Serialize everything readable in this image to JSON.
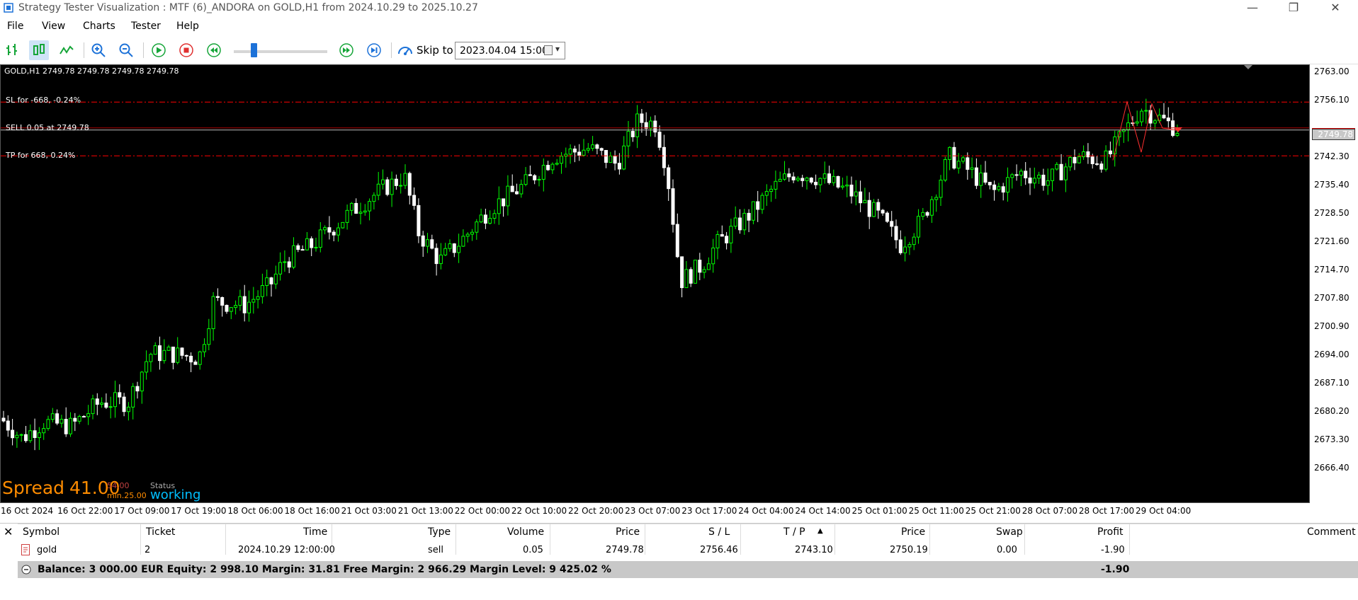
{
  "window": {
    "title": "Strategy Tester Visualization : MTF (6)_ANDORA on GOLD,H1 from 2024.10.29 to 2025.10.27"
  },
  "menu": [
    "File",
    "View",
    "Charts",
    "Tester",
    "Help"
  ],
  "toolbar": {
    "skip_label": "Skip to",
    "skip_date": "2023.04.04 15:00",
    "speed_level": 0.18
  },
  "chart": {
    "symbol_line": "GOLD,H1  2749.78 2749.78 2749.78 2749.78",
    "sl_label": "SL for -668, -0.24%",
    "sell_label": "SELL 0.05 at 2749.78",
    "tp_label": "TP for 668, 0.24%",
    "current_price": "2749.78",
    "price_ticks": [
      "2763.00",
      "2756.10",
      "2742.30",
      "2735.40",
      "2728.50",
      "2721.60",
      "2714.70",
      "2707.80",
      "2700.90",
      "2694.00",
      "2687.10",
      "2680.20",
      "2673.30",
      "2666.40"
    ],
    "time_ticks": [
      "16 Oct 2024",
      "16 Oct 22:00",
      "17 Oct 09:00",
      "17 Oct 19:00",
      "18 Oct 06:00",
      "18 Oct 16:00",
      "21 Oct 03:00",
      "21 Oct 13:00",
      "22 Oct 00:00",
      "22 Oct 10:00",
      "22 Oct 20:00",
      "23 Oct 07:00",
      "23 Oct 17:00",
      "24 Oct 04:00",
      "24 Oct 14:00",
      "25 Oct 01:00",
      "25 Oct 11:00",
      "25 Oct 21:00",
      "28 Oct 07:00",
      "28 Oct 17:00",
      "29 Oct 04:00"
    ],
    "spread_label": "Spread",
    "spread_value": "41.00",
    "status_label": "Status",
    "status_value": "working",
    "small_max": "54.00",
    "small_min": "min.25.00",
    "colors": {
      "bull": "#00ff00",
      "bear": "#ffffff",
      "sl_tp_line": "#ff0000",
      "spread": "#ff8c00",
      "status": "#00bfff"
    }
  },
  "trades_table": {
    "headers": [
      "Symbol",
      "Ticket",
      "Time",
      "Type",
      "Volume",
      "Price",
      "S / L",
      "T / P",
      "Price",
      "Swap",
      "Profit",
      "Comment"
    ],
    "row": {
      "symbol": "gold",
      "ticket": "2",
      "time": "2024.10.29 12:00:00",
      "type": "sell",
      "volume": "0.05",
      "price": "2749.78",
      "sl": "2756.46",
      "tp": "2743.10",
      "cur_price": "2750.19",
      "swap": "0.00",
      "profit": "-1.90",
      "comment": ""
    },
    "balance_line": "Balance: 3 000.00 EUR  Equity: 2 998.10  Margin: 31.81  Free Margin: 2 966.29  Margin Level: 9 425.02 %",
    "total_profit": "-1.90"
  }
}
